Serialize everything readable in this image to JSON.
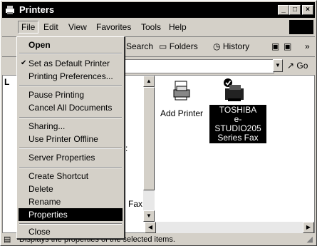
{
  "window": {
    "title": "Printers"
  },
  "menubar": {
    "items": [
      "File",
      "Edit",
      "View",
      "Favorites",
      "Tools",
      "Help"
    ]
  },
  "toolbar": {
    "search": "Search",
    "folders": "Folders",
    "history": "History",
    "more": "»"
  },
  "address": {
    "go": "Go"
  },
  "left_pane": {
    "letter": "L",
    "colon_char": ":",
    "fax_fragment": "Fax"
  },
  "items": [
    {
      "name": "Add Printer",
      "icon": "add-printer-icon"
    },
    {
      "name_lines": [
        "TOSHIBA",
        "e-STUDIO205",
        "Series Fax"
      ],
      "icon": "fax-printer-icon",
      "selected": true
    }
  ],
  "status": {
    "text": "Displays the properties of the selected items."
  },
  "file_menu": {
    "items": [
      {
        "label": "Open",
        "bold": true
      },
      {
        "sep": true
      },
      {
        "label": "Set as Default Printer",
        "checked": true
      },
      {
        "label": "Printing Preferences..."
      },
      {
        "sep": true
      },
      {
        "label": "Pause Printing"
      },
      {
        "label": "Cancel All Documents"
      },
      {
        "sep": true
      },
      {
        "label": "Sharing..."
      },
      {
        "label": "Use Printer Offline"
      },
      {
        "sep": true
      },
      {
        "label": "Server Properties"
      },
      {
        "sep": true
      },
      {
        "label": "Create Shortcut"
      },
      {
        "label": "Delete"
      },
      {
        "label": "Rename"
      },
      {
        "label": "Properties",
        "highlighted": true
      },
      {
        "sep": true
      },
      {
        "label": "Close"
      }
    ]
  }
}
